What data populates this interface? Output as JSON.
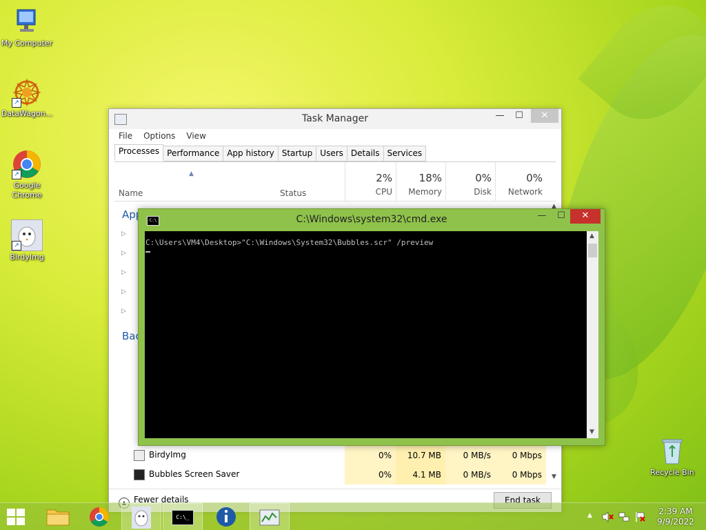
{
  "desktop": {
    "icons": [
      {
        "label": "My Computer"
      },
      {
        "label": "DataWagon..."
      },
      {
        "label": "Google Chrome"
      },
      {
        "label": "BirdyImg"
      },
      {
        "label": "Recycle Bin"
      }
    ]
  },
  "task_manager": {
    "title": "Task Manager",
    "menu": [
      "File",
      "Options",
      "View"
    ],
    "tabs": [
      "Processes",
      "Performance",
      "App history",
      "Startup",
      "Users",
      "Details",
      "Services"
    ],
    "active_tab": "Processes",
    "columns": {
      "name": "Name",
      "status": "Status",
      "cpu": {
        "pct": "2%",
        "label": "CPU"
      },
      "memory": {
        "pct": "18%",
        "label": "Memory"
      },
      "disk": {
        "pct": "0%",
        "label": "Disk"
      },
      "network": {
        "pct": "0%",
        "label": "Network"
      }
    },
    "group_apps": "App",
    "group_background": "Bac",
    "rows": [
      {
        "name": "BirdyImg",
        "cpu": "0%",
        "memory": "10.7 MB",
        "disk": "0 MB/s",
        "network": "0 Mbps"
      },
      {
        "name": "Bubbles Screen Saver",
        "cpu": "0%",
        "memory": "4.1 MB",
        "disk": "0 MB/s",
        "network": "0 Mbps"
      }
    ],
    "fewer_details": "Fewer details",
    "end_task": "End task"
  },
  "cmd": {
    "title": "C:\\Windows\\system32\\cmd.exe",
    "icon_text": "C:\\",
    "line1": "C:\\Users\\VM4\\Desktop>\"C:\\Windows\\System32\\Bubbles.scr\" /preview"
  },
  "taskbar": {
    "cmd_icon_text": "C:\\_",
    "clock_time": "2:39 AM",
    "clock_date": "9/9/2022"
  },
  "colors": {
    "cmd_frame": "#8fc24b",
    "group_header": "#1e5aa8",
    "heat_cell": "#fff4c4"
  }
}
